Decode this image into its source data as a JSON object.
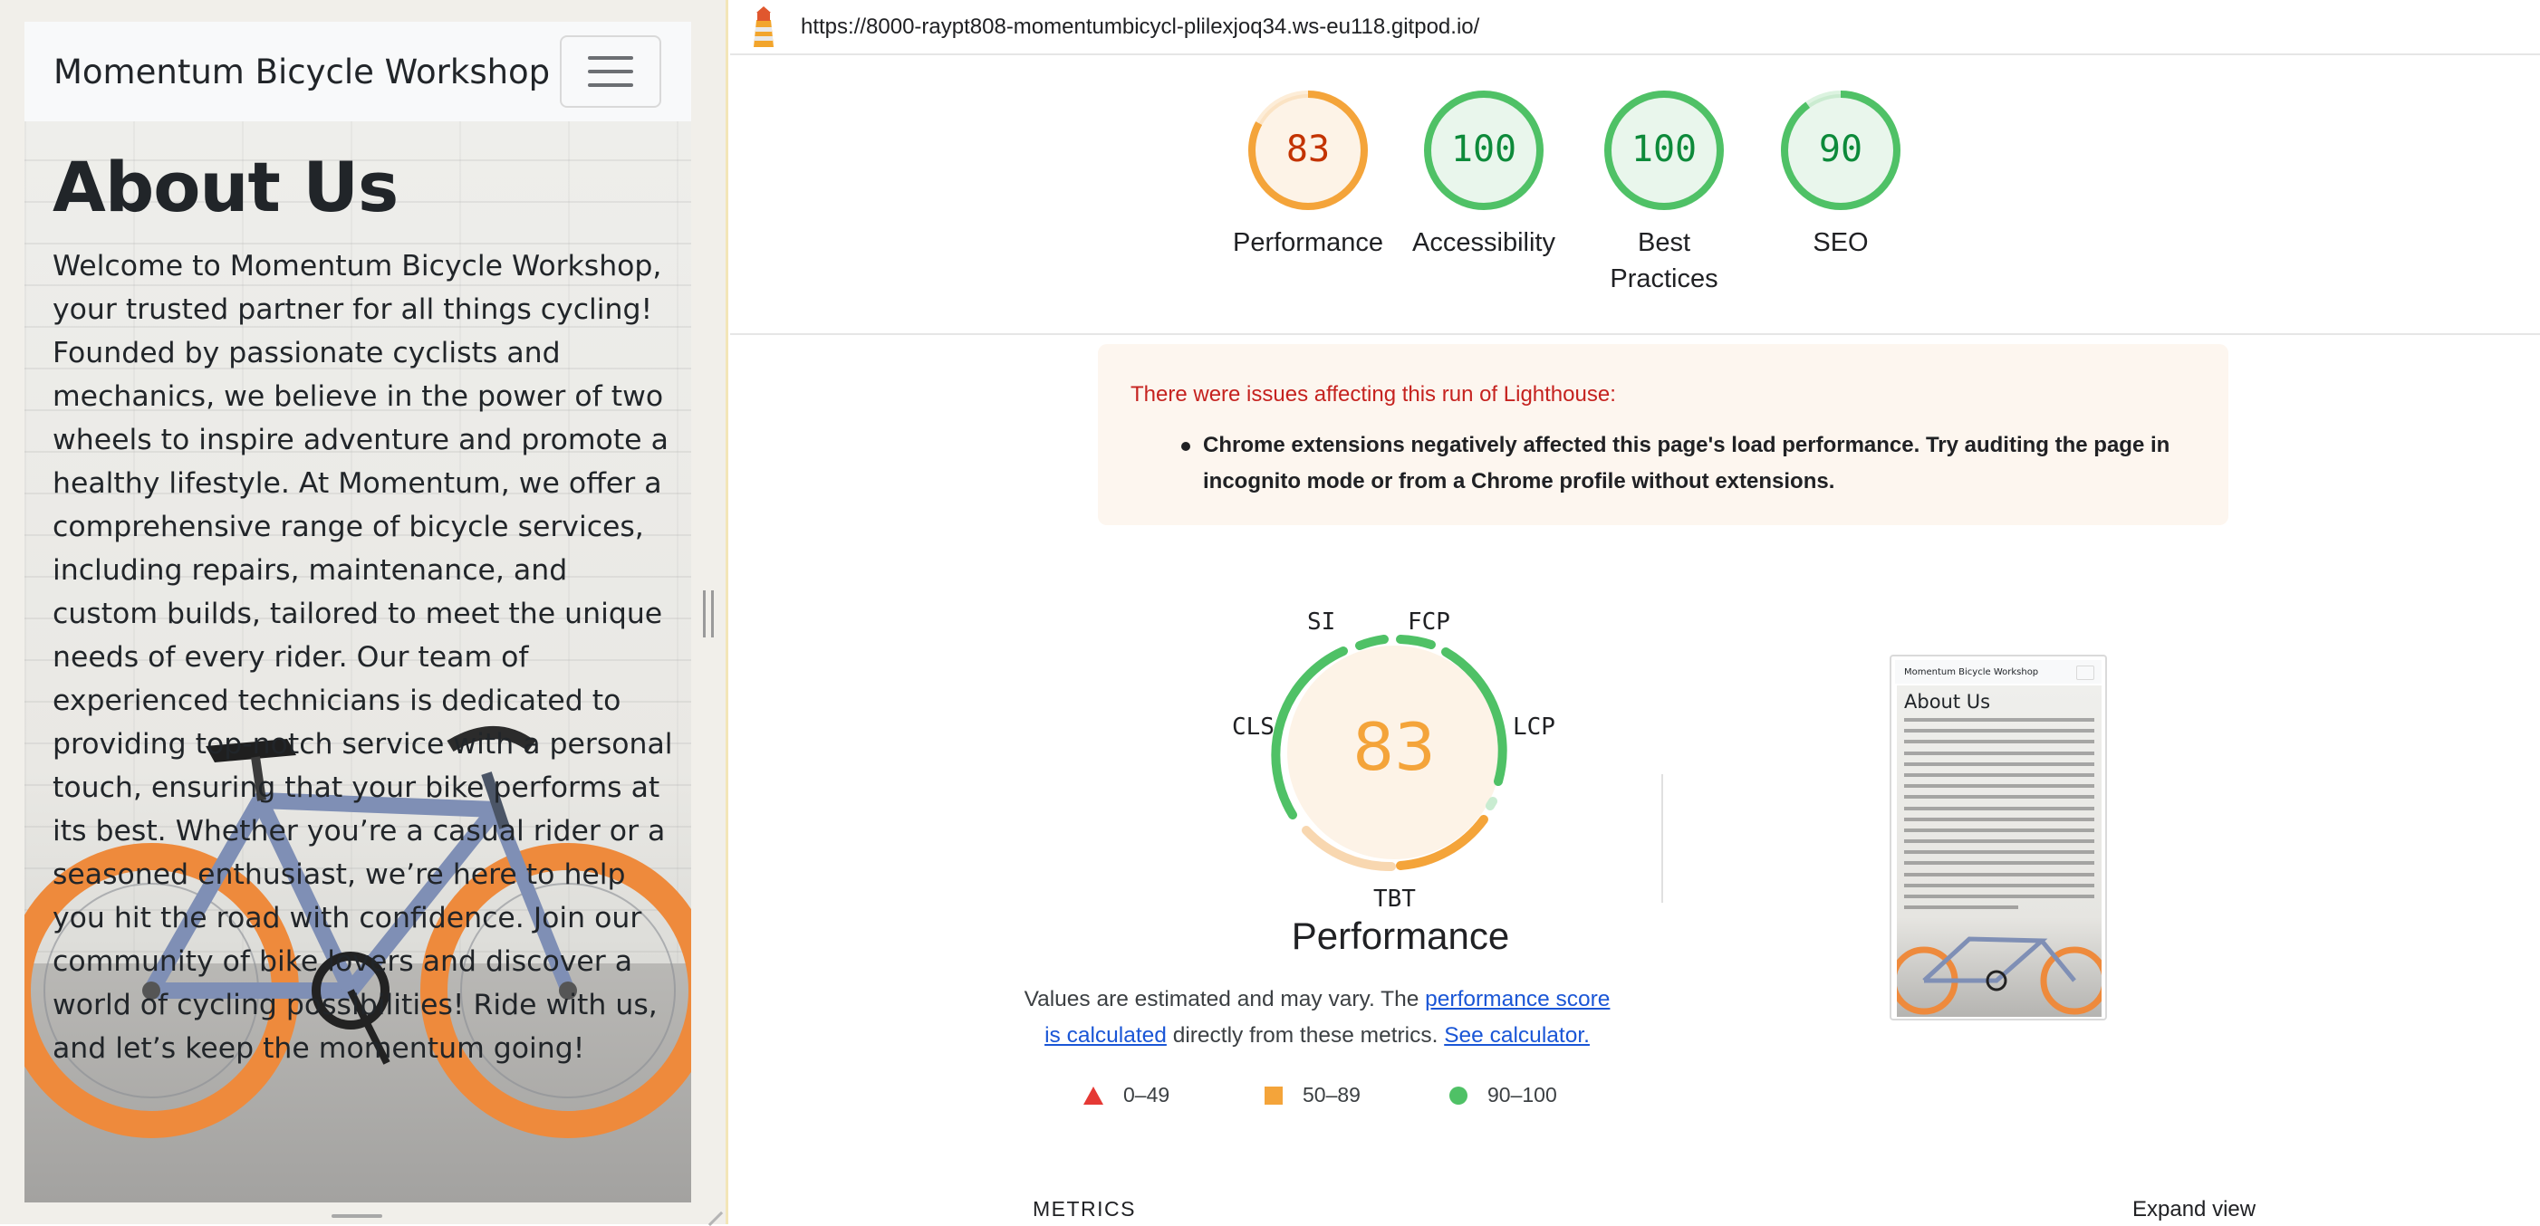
{
  "website": {
    "brand": "Momentum Bicycle Workshop",
    "heading": "About Us",
    "body": "Welcome to Momentum Bicycle Workshop, your trusted partner for all things cycling! Founded by passionate cyclists and mechanics, we believe in the power of two wheels to inspire adventure and promote a healthy lifestyle. At Momentum, we offer a comprehensive range of bicycle services, including repairs, maintenance, and custom builds, tailored to meet the unique needs of every rider. Our team of experienced technicians is dedicated to providing top-notch service with a personal touch, ensuring that your bike performs at its best. Whether you’re a casual rider or a seasoned enthusiast, we’re here to help you hit the road with confidence. Join our community of bike lovers and discover a world of cycling possibilities! Ride with us, and let’s keep the momentum going!"
  },
  "report": {
    "url": "https://8000-raypt808-momentumbicycl-plilexjoq34.ws-eu118.gitpod.io/",
    "scores": [
      {
        "label": "Performance",
        "value": 83,
        "color": "#f4a43a",
        "text_color": "#c33300",
        "bg": "#fdf3e7"
      },
      {
        "label": "Accessibility",
        "value": 100,
        "color": "#4fc166",
        "text_color": "#0d8a3a",
        "bg": "#e9f6ec"
      },
      {
        "label": "Best Practices",
        "value": 100,
        "color": "#4fc166",
        "text_color": "#0d8a3a",
        "bg": "#e9f6ec"
      },
      {
        "label": "SEO",
        "value": 90,
        "color": "#4fc166",
        "text_color": "#0d8a3a",
        "bg": "#e9f6ec"
      }
    ],
    "warning": {
      "title": "There were issues affecting this run of Lighthouse:",
      "item": "Chrome extensions negatively affected this page's load performance. Try auditing the page in incognito mode or from a Chrome profile without extensions."
    },
    "performance": {
      "score": 83,
      "title": "Performance",
      "metric_tags": [
        "SI",
        "FCP",
        "LCP",
        "TBT",
        "CLS"
      ],
      "note_prefix": "Values are estimated and may vary. The ",
      "note_link1": "performance score is calculated",
      "note_mid": " directly from these metrics. ",
      "note_link2": "See calculator."
    },
    "legend": [
      "0–49",
      "50–89",
      "90–100"
    ],
    "metrics_heading": "METRICS",
    "expand_view": "Expand view",
    "thumbnail": {
      "brand": "Momentum Bicycle Workshop",
      "heading": "About Us"
    }
  },
  "colors": {
    "fail": "#e53935",
    "average": "#f4a43a",
    "pass": "#4fc166"
  }
}
